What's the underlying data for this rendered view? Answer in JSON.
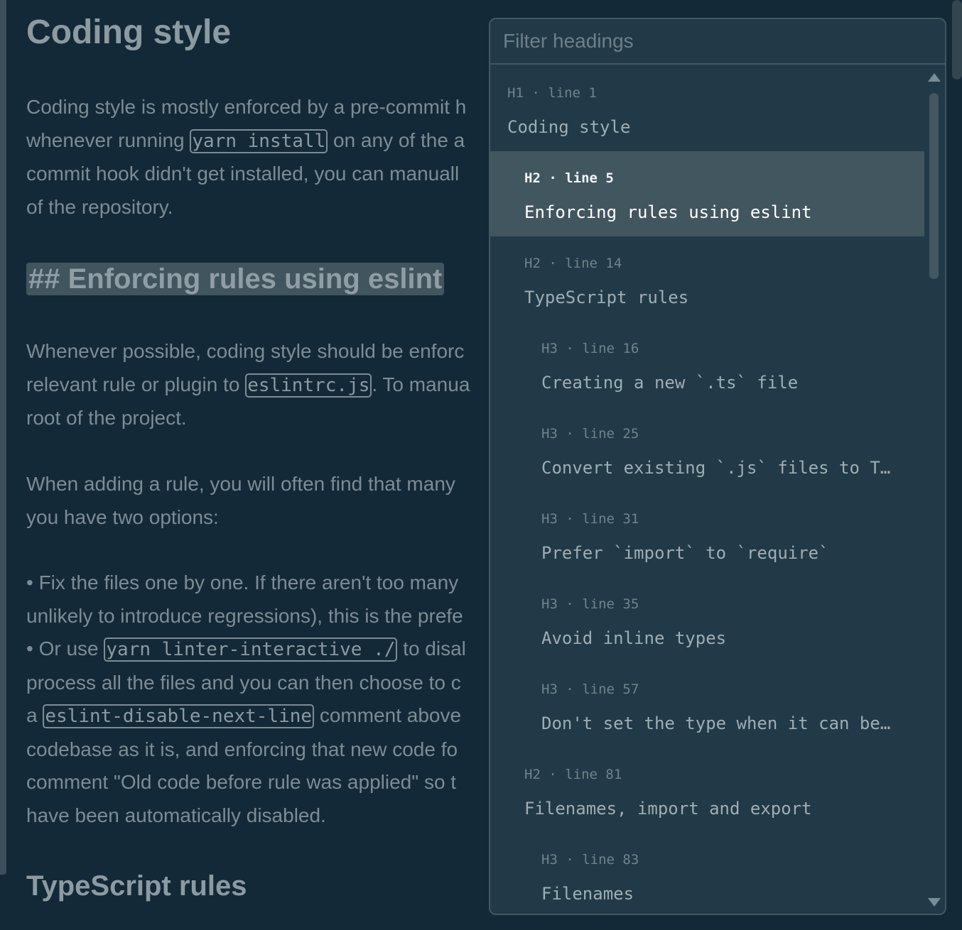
{
  "document": {
    "h1": "Coding style",
    "p1": {
      "l1": "Coding style is mostly enforced by a pre-commit h",
      "l2a": "whenever running ",
      "code1": "yarn install",
      "l2b": " on any of the a",
      "l3": "commit hook didn't get installed, you can manuall",
      "l4": "of the repository."
    },
    "h2_active": "## Enforcing rules using eslint",
    "p2": {
      "l1": "Whenever possible, coding style should be enforc",
      "l2a": "relevant rule or plugin to ",
      "code1": "eslintrc.js",
      "l2b": ". To manua",
      "l3": "root of the project."
    },
    "p3": {
      "l1": "When adding a rule, you will often find that many",
      "l2": "you have two options:"
    },
    "list": {
      "b1l1": "• Fix the files one by one. If there aren't too many",
      "b1l2": "unlikely to introduce regressions), this is the prefe",
      "b2l1a": "• Or use ",
      "code1": "yarn linter-interactive ./",
      "b2l1b": " to disal",
      "b2l2": "process all the files and you can then choose to c",
      "b2l3a": "a ",
      "code2": "eslint-disable-next-line",
      "b2l3b": " comment above",
      "b2l4": "codebase as it is, and enforcing that new code fo",
      "b2l5": "comment \"Old code before rule was applied\" so t",
      "b2l6": "have been automatically disabled."
    },
    "h2_ts": "TypeScript rules"
  },
  "outline": {
    "filter_placeholder": "Filter headings",
    "filter_value": "",
    "items": [
      {
        "meta": "H1 · line 1",
        "title": "Coding style"
      },
      {
        "meta": "H2 · line 5",
        "title": "Enforcing rules using eslint"
      },
      {
        "meta": "H2 · line 14",
        "title": "TypeScript rules"
      },
      {
        "meta": "H3 · line 16",
        "title": "Creating a new `.ts` file"
      },
      {
        "meta": "H3 · line 25",
        "title": "Convert existing `.js` files to Ty…"
      },
      {
        "meta": "H3 · line 31",
        "title": "Prefer `import` to `require`"
      },
      {
        "meta": "H3 · line 35",
        "title": "Avoid inline types"
      },
      {
        "meta": "H3 · line 57",
        "title": "Don't set the type when it can be …"
      },
      {
        "meta": "H2 · line 81",
        "title": "Filenames, import and export"
      },
      {
        "meta": "H3 · line 83",
        "title": "Filenames"
      }
    ]
  }
}
